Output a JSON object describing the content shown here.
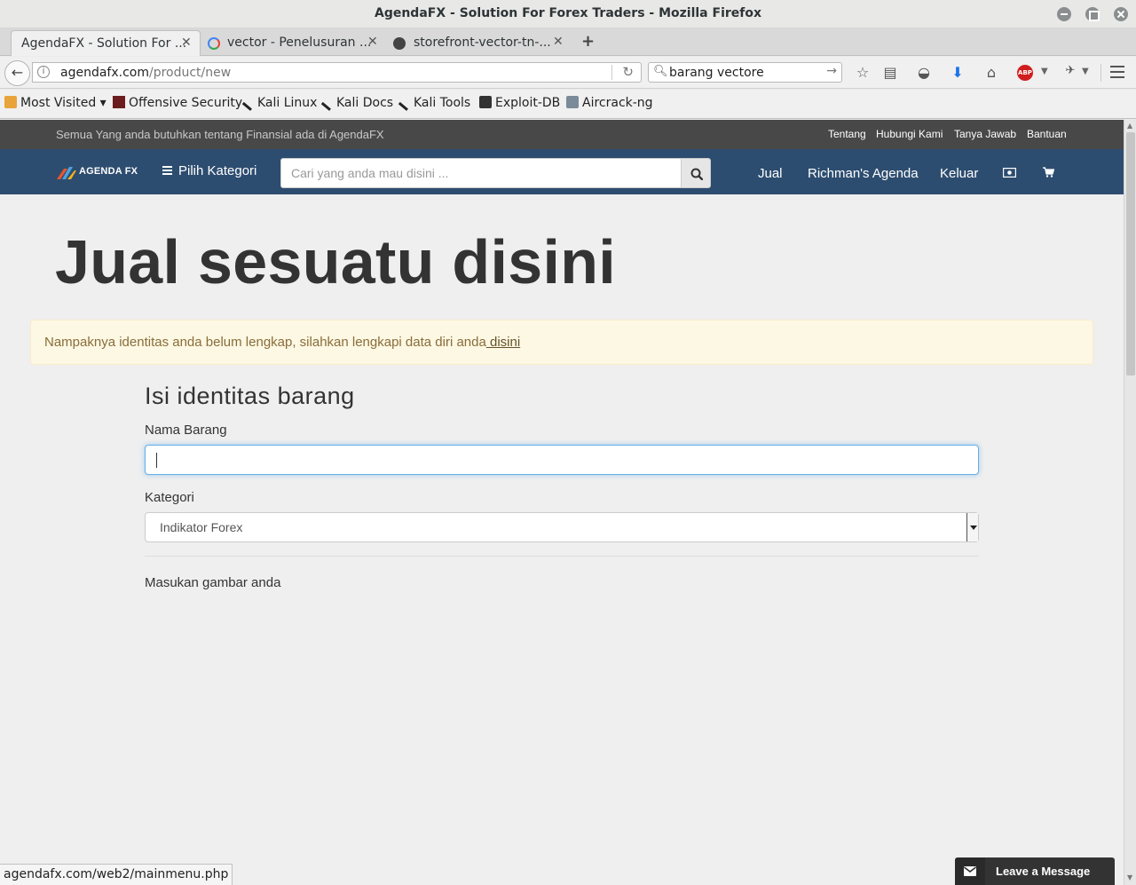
{
  "window": {
    "title": "AgendaFX - Solution For Forex Traders - Mozilla Firefox"
  },
  "tabs": [
    {
      "label": "AgendaFX - Solution For ...",
      "active": true
    },
    {
      "label": "vector - Penelusuran ...",
      "active": false
    },
    {
      "label": "storefront-vector-tn-...",
      "active": false
    }
  ],
  "toolbar": {
    "url_host": "agendafx.com",
    "url_path": "/product/new",
    "search_value": "barang vectore"
  },
  "bookmarks": [
    "Most Visited",
    "Offensive Security",
    "Kali Linux",
    "Kali Docs",
    "Kali Tools",
    "Exploit-DB",
    "Aircrack-ng"
  ],
  "site": {
    "tagline": "Semua Yang anda butuhkan tentang Finansial ada di AgendaFX",
    "top_links": [
      "Tentang",
      "Hubungi Kami",
      "Tanya Jawab",
      "Bantuan"
    ],
    "logo_text": "AGENDA FX",
    "category_button": "Pilih Kategori",
    "search_placeholder": "Cari yang anda mau disini ...",
    "nav_links": [
      "Jual",
      "Richman's Agenda",
      "Keluar"
    ],
    "colors": {
      "nav_bg": "#2d4d70",
      "top_bg": "#484848",
      "alert_bg": "#fcf8e3"
    }
  },
  "page": {
    "heading": "Jual sesuatu disini",
    "alert_text": "Nampaknya identitas anda belum lengkap, silahkan lengkapi data diri anda",
    "alert_link": " disini",
    "form_title": "Isi identitas barang",
    "name_label": "Nama Barang",
    "name_value": "",
    "category_label": "Kategori",
    "category_selected": "Indikator Forex",
    "image_label": "Masukan gambar anda"
  },
  "status": {
    "url": "agendafx.com/web2/mainmenu.php"
  },
  "chat": {
    "label": "Leave a Message"
  }
}
